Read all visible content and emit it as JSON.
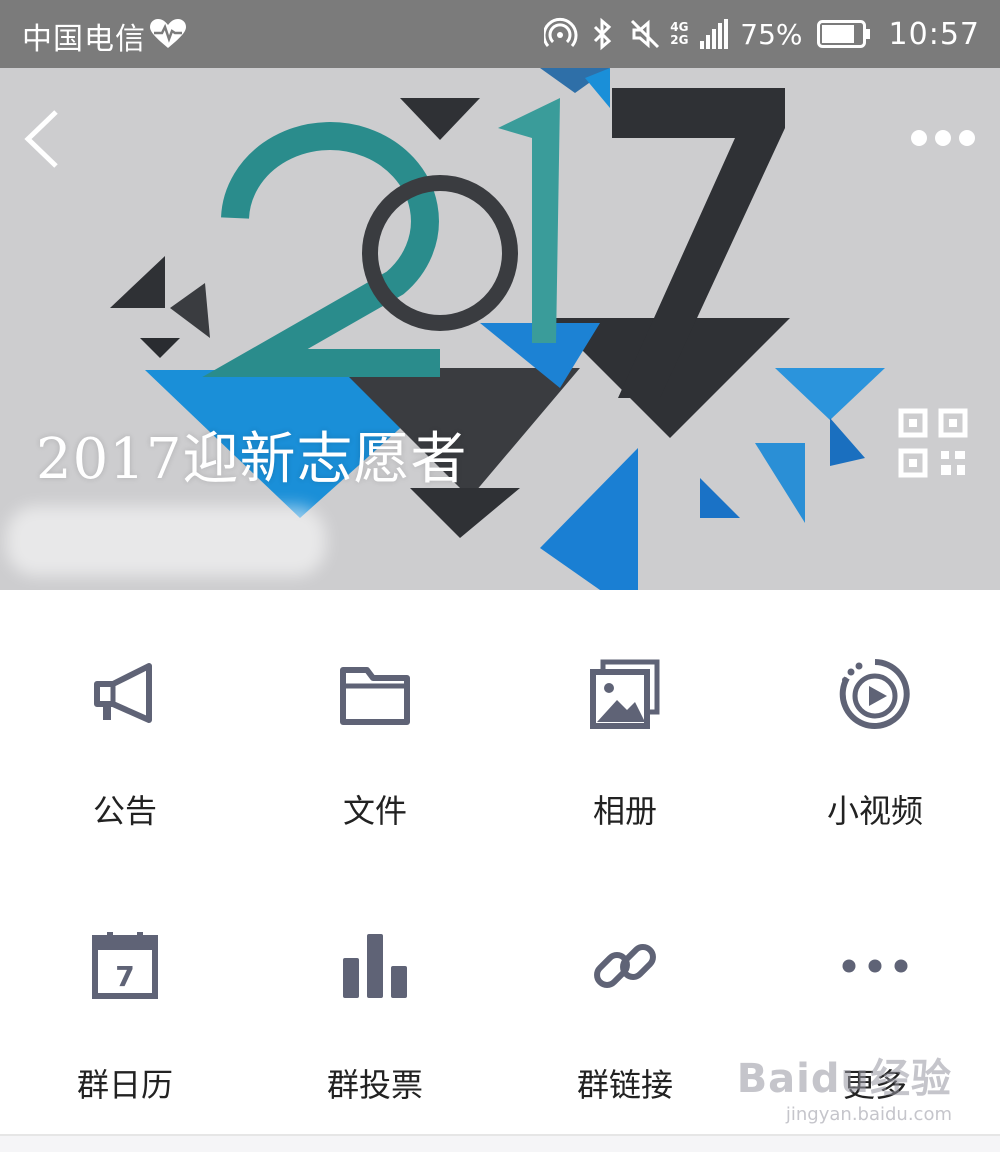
{
  "status_bar": {
    "carrier": "中国电信",
    "network_top": "4G",
    "network_bottom": "2G",
    "battery_percent": "75%",
    "time": "10:57"
  },
  "banner": {
    "group_name": "2017迎新志愿者"
  },
  "menu": {
    "items": [
      {
        "label": "公告",
        "icon": "megaphone-icon"
      },
      {
        "label": "文件",
        "icon": "folder-icon"
      },
      {
        "label": "相册",
        "icon": "album-icon"
      },
      {
        "label": "小视频",
        "icon": "video-icon"
      },
      {
        "label": "群日历",
        "icon": "calendar-icon",
        "calendar_day": "7"
      },
      {
        "label": "群投票",
        "icon": "bar-chart-icon"
      },
      {
        "label": "群链接",
        "icon": "link-icon"
      },
      {
        "label": "更多",
        "icon": "more-dots-icon"
      }
    ]
  },
  "watermark": {
    "brand": "Baidu经验",
    "url": "jingyan.baidu.com"
  },
  "colors": {
    "status_bar": "#7b7b7b",
    "banner_bg": "#cdcdcf",
    "icon_gray": "#5f6376",
    "teal": "#2a8c8c",
    "blue": "#1a7fd3",
    "dark": "#2f3135"
  }
}
